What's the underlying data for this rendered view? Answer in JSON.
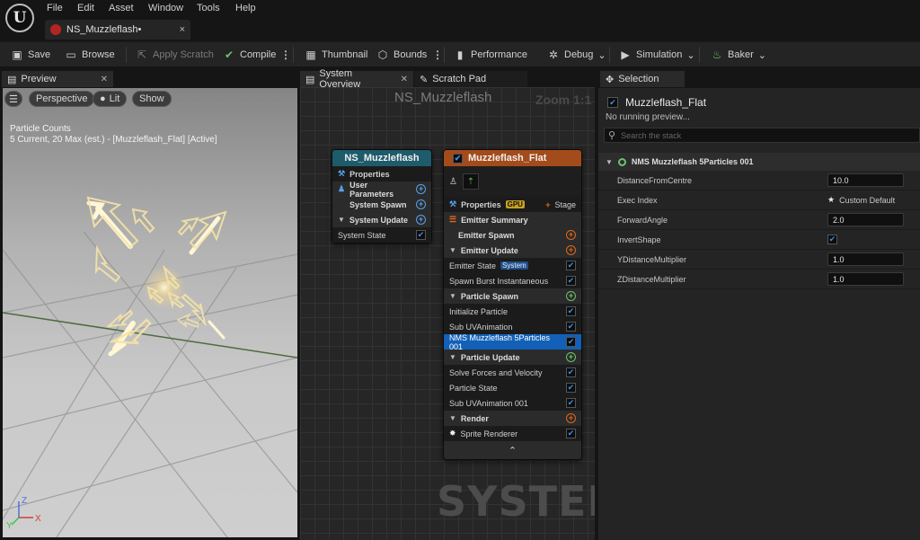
{
  "menu": [
    "File",
    "Edit",
    "Asset",
    "Window",
    "Tools",
    "Help"
  ],
  "document_tab": {
    "title": "NS_Muzzleflash•",
    "close": "×"
  },
  "toolbar": {
    "save": "Save",
    "browse": "Browse",
    "apply_scratch": "Apply Scratch",
    "compile": "Compile",
    "thumbnail": "Thumbnail",
    "bounds": "Bounds",
    "performance": "Performance",
    "debug": "Debug",
    "simulation": "Simulation",
    "baker": "Baker"
  },
  "preview": {
    "tab": "Preview",
    "perspective": "Perspective",
    "lit": "Lit",
    "show": "Show",
    "counts_title": "Particle Counts",
    "counts_text": "5 Current, 20 Max (est.) - [Muzzleflash_Flat] [Active]",
    "axis": {
      "z": "Z",
      "x": "X",
      "y": "Y"
    }
  },
  "graph": {
    "tab_overview": "System Overview",
    "tab_scratch": "Scratch Pad",
    "title": "NS_Muzzleflash",
    "zoom": "Zoom 1:1",
    "watermark": "SYSTEM",
    "system_node": {
      "header": "NS_Muzzleflash",
      "rows": [
        "Properties",
        "User Parameters",
        "System Spawn",
        "System Update",
        "System State"
      ]
    },
    "emitter_node": {
      "header": "Muzzleflash_Flat",
      "properties": "Properties",
      "gpu": "GPU",
      "stage": "Stage",
      "summary": "Emitter Summary",
      "emitter_spawn": "Emitter Spawn",
      "emitter_update": "Emitter Update",
      "emitter_state": "Emitter State",
      "system_tag": "System",
      "spawn_burst": "Spawn Burst Instantaneous",
      "particle_spawn": "Particle Spawn",
      "initialize": "Initialize Particle",
      "sub_uv": "Sub UVAnimation",
      "nms_module": "NMS Muzzleflash 5Particles 001",
      "particle_update": "Particle Update",
      "solve_forces": "Solve Forces and Velocity",
      "particle_state": "Particle State",
      "sub_uv_001": "Sub UVAnimation 001",
      "render": "Render",
      "sprite_renderer": "Sprite Renderer",
      "chevron": "⌃"
    }
  },
  "selection": {
    "tab": "Selection",
    "emitter": "Muzzleflash_Flat",
    "status": "No running preview...",
    "search_placeholder": "Search the stack",
    "module": "NMS Muzzleflash 5Particles 001",
    "props": [
      {
        "name": "DistanceFromCentre",
        "value": "10.0"
      },
      {
        "name": "Exec Index",
        "value": "Custom Default"
      },
      {
        "name": "ForwardAngle",
        "value": "2.0"
      },
      {
        "name": "InvertShape",
        "value": ""
      },
      {
        "name": "YDistanceMultiplier",
        "value": "1.0"
      },
      {
        "name": "ZDistanceMultiplier",
        "value": "1.0"
      }
    ]
  },
  "colors": {
    "system_header": "#1e5b6b",
    "emitter_header": "#a34b1b",
    "highlight": "#1260b8",
    "accent_blue": "#3d8fe0"
  }
}
